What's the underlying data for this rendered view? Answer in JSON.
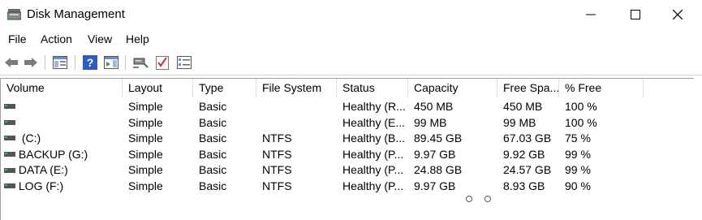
{
  "window": {
    "title": "Disk Management"
  },
  "menu": [
    "File",
    "Action",
    "View",
    "Help"
  ],
  "columns": [
    "Volume",
    "Layout",
    "Type",
    "File System",
    "Status",
    "Capacity",
    "Free Spa...",
    "% Free"
  ],
  "rows": [
    {
      "volume": "",
      "layout": "Simple",
      "type": "Basic",
      "fs": "",
      "status": "Healthy (R...",
      "capacity": "450 MB",
      "free": "450 MB",
      "pct": "100 %"
    },
    {
      "volume": "",
      "layout": "Simple",
      "type": "Basic",
      "fs": "",
      "status": "Healthy (E...",
      "capacity": "99 MB",
      "free": "99 MB",
      "pct": "100 %"
    },
    {
      "volume": "(C:)",
      "layout": "Simple",
      "type": "Basic",
      "fs": "NTFS",
      "status": "Healthy (B...",
      "capacity": "89.45 GB",
      "free": "67.03 GB",
      "pct": "75 %"
    },
    {
      "volume": "BACKUP (G:)",
      "layout": "Simple",
      "type": "Basic",
      "fs": "NTFS",
      "status": "Healthy (P...",
      "capacity": "9.97 GB",
      "free": "9.92 GB",
      "pct": "99 %"
    },
    {
      "volume": "DATA (E:)",
      "layout": "Simple",
      "type": "Basic",
      "fs": "NTFS",
      "status": "Healthy (P...",
      "capacity": "24.88 GB",
      "free": "24.57 GB",
      "pct": "99 %"
    },
    {
      "volume": "LOG (F:)",
      "layout": "Simple",
      "type": "Basic",
      "fs": "NTFS",
      "status": "Healthy (P...",
      "capacity": "9.97 GB",
      "free": "8.93 GB",
      "pct": "90 %"
    }
  ]
}
